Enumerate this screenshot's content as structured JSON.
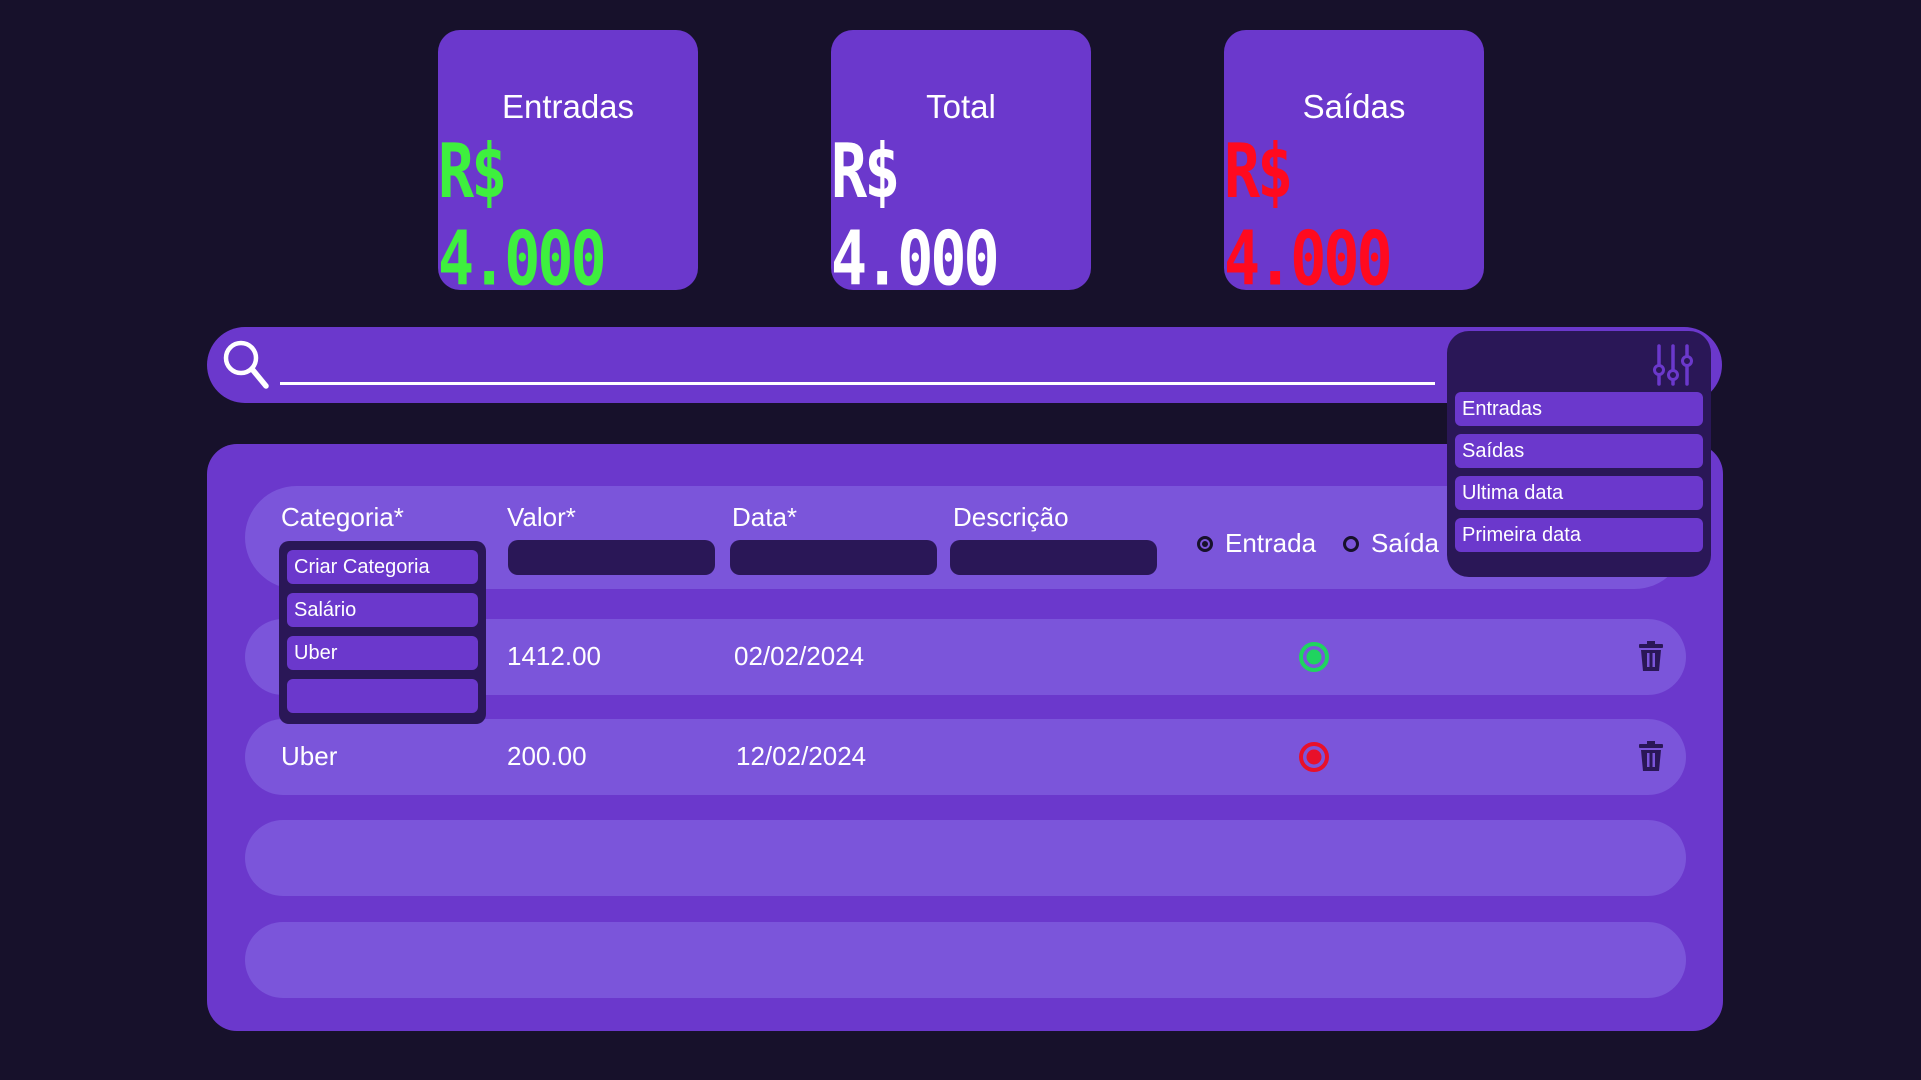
{
  "summary": {
    "entradas": {
      "title": "Entradas",
      "value": "R$ 4.000",
      "color": "#3ef03e"
    },
    "total": {
      "title": "Total",
      "value": "R$ 4.000",
      "color": "#ffffff"
    },
    "saidas": {
      "title": "Saídas",
      "value": "R$ 4.000",
      "color": "#ff0a1f"
    }
  },
  "search": {
    "value": "",
    "placeholder": ""
  },
  "filter": {
    "icon": "sliders-icon",
    "options": [
      "Entradas",
      "Saídas",
      "Ultima data",
      "Primeira data"
    ]
  },
  "form": {
    "categoria_label": "Categoria*",
    "valor_label": "Valor*",
    "data_label": "Data*",
    "descricao_label": "Descrição",
    "valor_value": "",
    "data_value": "",
    "descricao_value": "",
    "type_options": {
      "entrada": "Entrada",
      "saida": "Saída"
    },
    "selected_type": "Entrada",
    "category_options": [
      "Criar Categoria",
      "Salário",
      "Uber",
      ""
    ]
  },
  "transactions": [
    {
      "categoria": "",
      "valor": "1412.00",
      "data": "02/02/2024",
      "descricao": "",
      "tipo": "Entrada"
    },
    {
      "categoria": "Uber",
      "valor": "200.00",
      "data": "12/02/2024",
      "descricao": "",
      "tipo": "Saída"
    },
    {
      "categoria": "",
      "valor": "",
      "data": "",
      "descricao": "",
      "tipo": ""
    },
    {
      "categoria": "",
      "valor": "",
      "data": "",
      "descricao": "",
      "tipo": ""
    }
  ],
  "colors": {
    "background": "#17112b",
    "accent": "#6b38cc",
    "row": "#7b55da",
    "dark": "#2a1757",
    "entrada": "#1fd45f",
    "saida": "#e8102a"
  }
}
